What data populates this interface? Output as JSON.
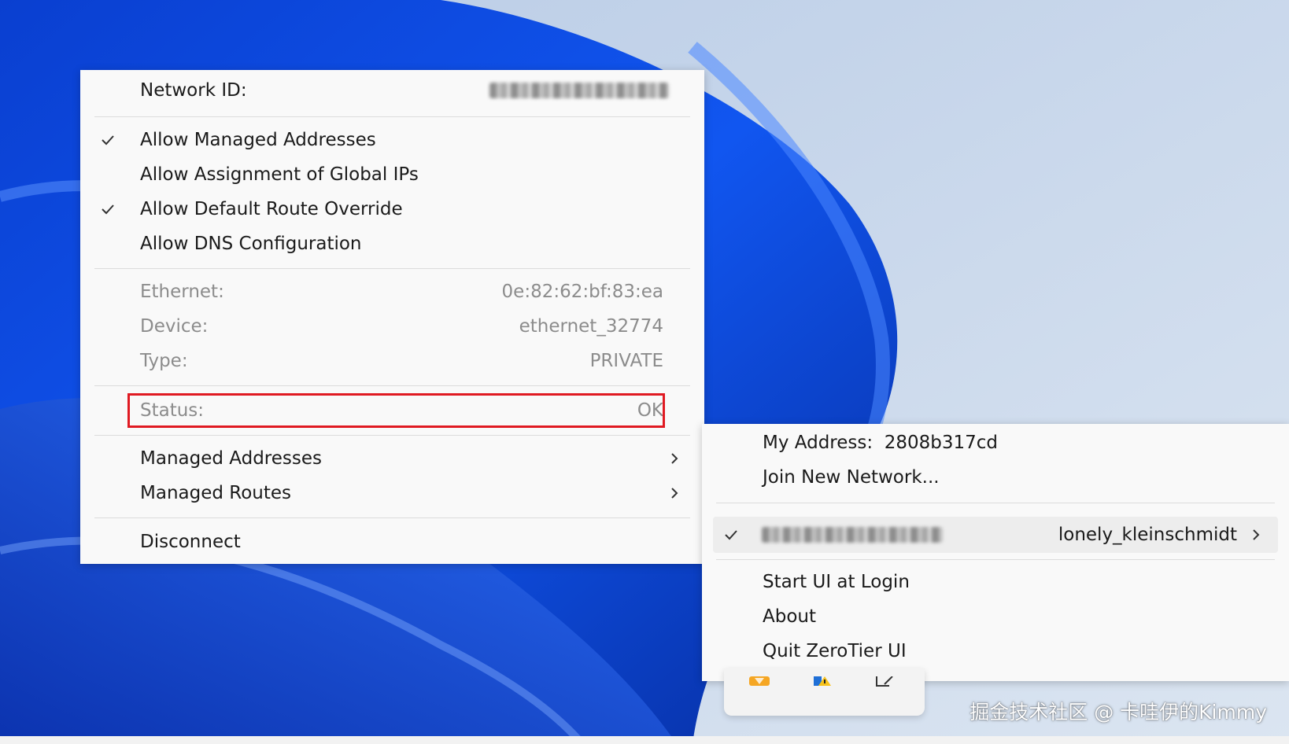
{
  "network_menu": {
    "network_id_label": "Network ID:",
    "options": [
      {
        "label": "Allow Managed Addresses",
        "checked": true
      },
      {
        "label": "Allow Assignment of Global IPs",
        "checked": false
      },
      {
        "label": "Allow Default Route Override",
        "checked": true
      },
      {
        "label": "Allow DNS Configuration",
        "checked": false
      }
    ],
    "info": [
      {
        "label": "Ethernet:",
        "value": "0e:82:62:bf:83:ea"
      },
      {
        "label": "Device:",
        "value": "ethernet_32774"
      },
      {
        "label": "Type:",
        "value": "PRIVATE"
      }
    ],
    "status": {
      "label": "Status:",
      "value": "OK"
    },
    "submenus": [
      {
        "label": "Managed Addresses"
      },
      {
        "label": "Managed Routes"
      }
    ],
    "disconnect_label": "Disconnect"
  },
  "main_menu": {
    "my_address_label": "My Address:",
    "my_address_value": "2808b317cd",
    "join_label": "Join New Network...",
    "network_entry": {
      "name": "lonely_kleinschmidt",
      "checked": true
    },
    "items": [
      {
        "label": "Start UI at Login"
      },
      {
        "label": "About"
      },
      {
        "label": "Quit ZeroTier UI"
      }
    ]
  },
  "watermark": "掘金技术社区 @ 卡哇伊的Kimmy",
  "icons": {
    "check": "check-icon",
    "chevron": "chevron-right-icon",
    "tray": [
      "zerotier-tray-icon",
      "windows-security-icon",
      "pen-icon"
    ]
  },
  "colors": {
    "highlight": "#e01a22",
    "menu_bg": "#f9f9f9",
    "disabled_text": "#8c8c8c"
  }
}
